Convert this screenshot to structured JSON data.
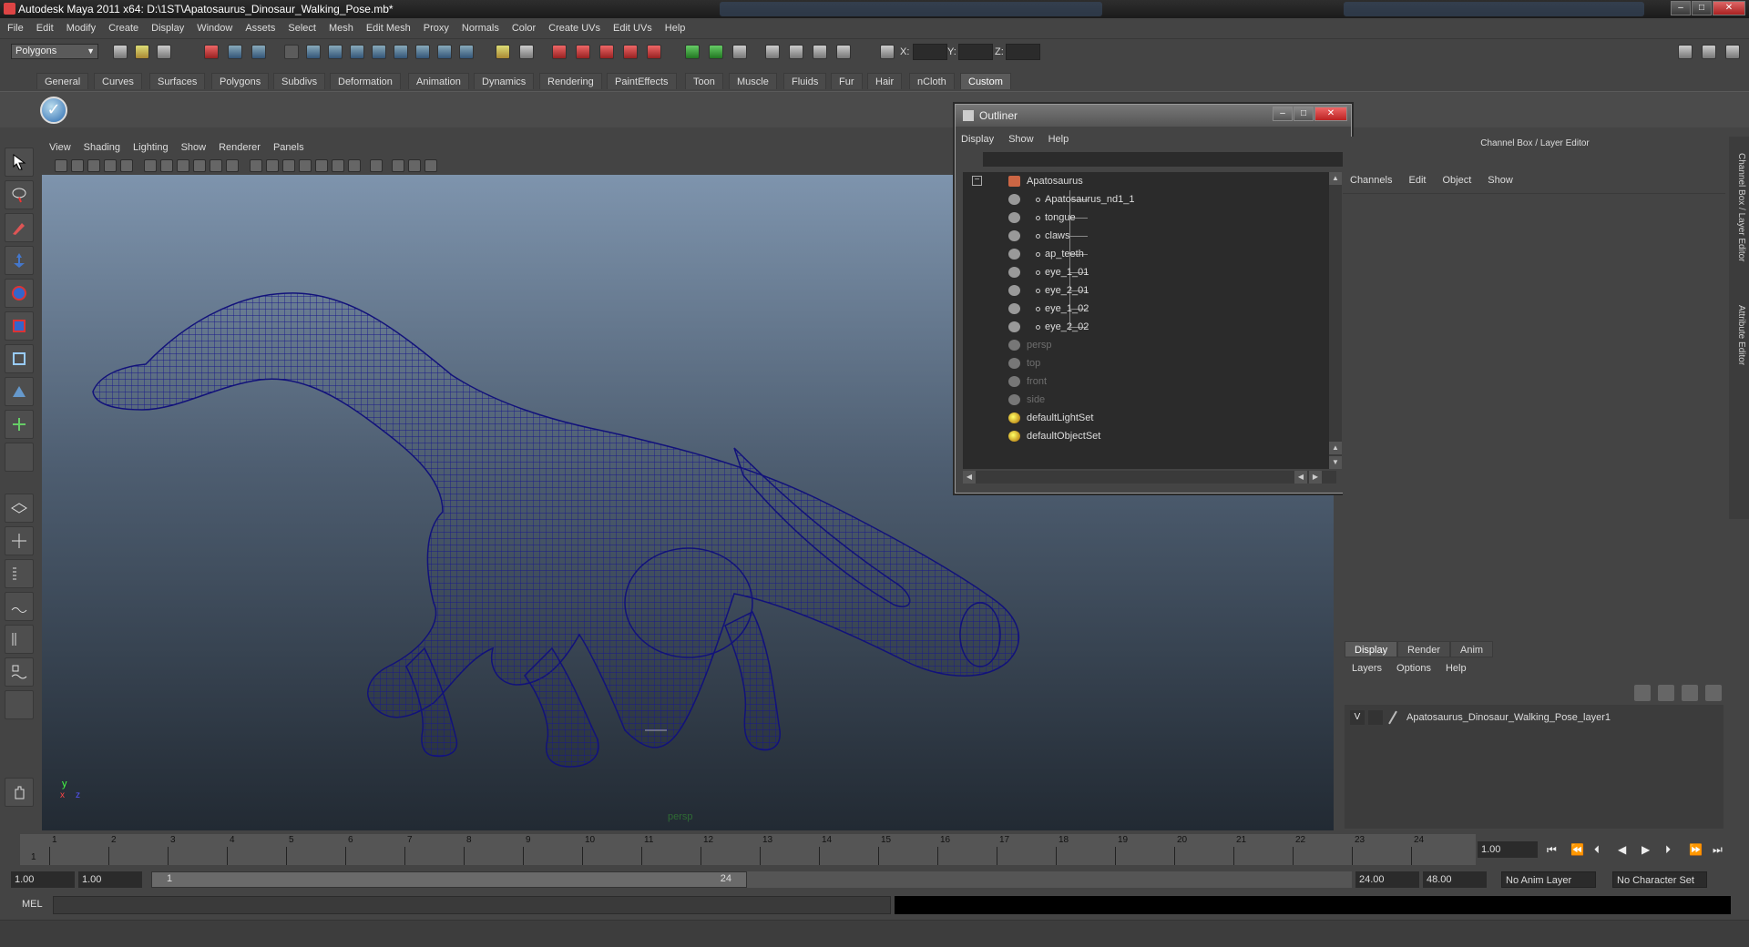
{
  "title": "Autodesk Maya 2011 x64: D:\\1ST\\Apatosaurus_Dinosaur_Walking_Pose.mb*",
  "menubar": [
    "File",
    "Edit",
    "Modify",
    "Create",
    "Display",
    "Window",
    "Assets",
    "Select",
    "Mesh",
    "Edit Mesh",
    "Proxy",
    "Normals",
    "Color",
    "Create UVs",
    "Edit UVs",
    "Help"
  ],
  "status": {
    "mode": "Polygons",
    "x_label": "X:",
    "y_label": "Y:",
    "z_label": "Z:"
  },
  "shelf_tabs": [
    "General",
    "Curves",
    "Surfaces",
    "Polygons",
    "Subdivs",
    "Deformation",
    "Animation",
    "Dynamics",
    "Rendering",
    "PaintEffects",
    "Toon",
    "Muscle",
    "Fluids",
    "Fur",
    "Hair",
    "nCloth",
    "Custom"
  ],
  "shelf_active": "Custom",
  "viewport": {
    "menu": [
      "View",
      "Shading",
      "Lighting",
      "Show",
      "Renderer",
      "Panels"
    ],
    "camera": "persp",
    "axis": {
      "x": "x",
      "y": "y",
      "z": "z"
    }
  },
  "outliner": {
    "title": "Outliner",
    "menu": [
      "Display",
      "Show",
      "Help"
    ],
    "root": "Apatosaurus",
    "children": [
      "Apatosaurus_nd1_1",
      "tongue",
      "claws",
      "ap_teeth",
      "eye_1_01",
      "eye_2_01",
      "eye_1_02",
      "eye_2_02"
    ],
    "cameras": [
      "persp",
      "top",
      "front",
      "side"
    ],
    "sets": [
      "defaultLightSet",
      "defaultObjectSet"
    ],
    "collapse_symbol": "−"
  },
  "channel_box": {
    "header": "Channel Box / Layer Editor",
    "menu": [
      "Channels",
      "Edit",
      "Object",
      "Show"
    ]
  },
  "side_tabs": [
    "Channel Box / Layer Editor",
    "Attribute Editor"
  ],
  "layers": {
    "tabs": [
      "Display",
      "Render",
      "Anim"
    ],
    "active_tab": "Display",
    "menu": [
      "Layers",
      "Options",
      "Help"
    ],
    "layer_name": "Apatosaurus_Dinosaur_Walking_Pose_layer1",
    "visible_flag": "V"
  },
  "time": {
    "ticks": [
      "1",
      "2",
      "3",
      "4",
      "5",
      "6",
      "7",
      "8",
      "9",
      "10",
      "11",
      "12",
      "13",
      "14",
      "15",
      "16",
      "17",
      "18",
      "19",
      "20",
      "21",
      "22",
      "23",
      "24"
    ],
    "start_frame": "1",
    "current_frame": "1.00"
  },
  "range": {
    "start": "1.00",
    "start2": "1.00",
    "thumb_left": "1",
    "thumb_right": "24",
    "end": "24.00",
    "end2": "48.00",
    "anim_layer": "No Anim Layer",
    "char_set": "No Character Set"
  },
  "cmd": {
    "label": "MEL"
  }
}
